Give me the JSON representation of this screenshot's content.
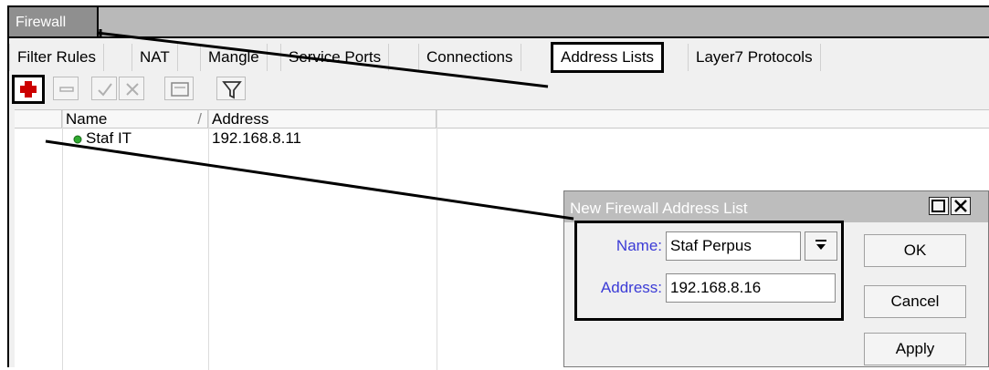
{
  "window": {
    "title": "Firewall"
  },
  "tabs": [
    {
      "label": "Filter Rules"
    },
    {
      "label": "NAT"
    },
    {
      "label": "Mangle"
    },
    {
      "label": "Service Ports"
    },
    {
      "label": "Connections"
    },
    {
      "label": "Address Lists",
      "active": true
    },
    {
      "label": "Layer7 Protocols"
    }
  ],
  "toolbar": {
    "buttons": [
      "add-icon",
      "remove-icon",
      "enable-icon",
      "disable-icon",
      "comment-icon",
      "filter-icon"
    ]
  },
  "table": {
    "columns": [
      "Name",
      "Address"
    ],
    "sort_indicator": "/",
    "rows": [
      {
        "status": "enabled",
        "name": "Staf IT",
        "address": "192.168.8.11"
      }
    ]
  },
  "dialog": {
    "title": "New Firewall Address List",
    "name_label": "Name:",
    "name_value": "Staf Perpus",
    "address_label": "Address:",
    "address_value": "192.168.8.16",
    "ok_label": "OK",
    "cancel_label": "Cancel",
    "apply_label": "Apply"
  },
  "colors": {
    "label_blue": "#3b3bd6",
    "add_red": "#cc0000",
    "status_green": "#2faa2f"
  }
}
